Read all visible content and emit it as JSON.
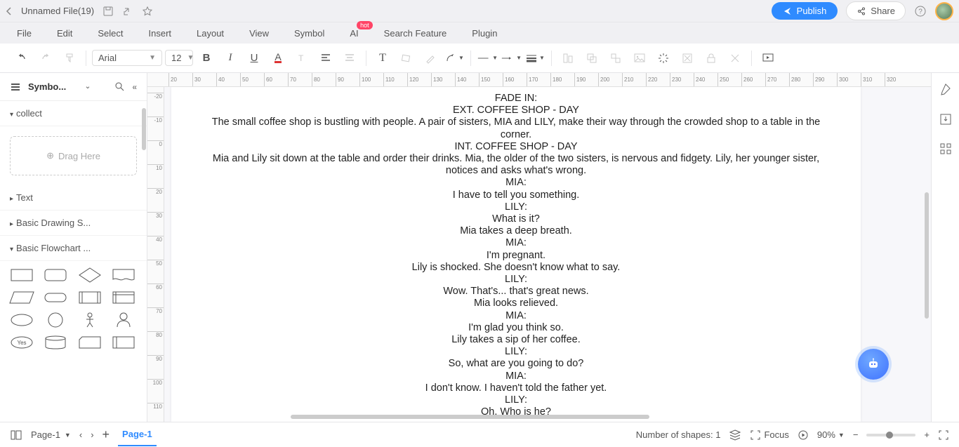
{
  "title": "Unnamed File(19)",
  "publish": "Publish",
  "share": "Share",
  "menu": [
    "File",
    "Edit",
    "Select",
    "Insert",
    "Layout",
    "View",
    "Symbol",
    "AI",
    "Search Feature",
    "Plugin"
  ],
  "ai_badge": "hot",
  "font_name": "Arial",
  "font_size": "12",
  "sidebar": {
    "title": "Symbo...",
    "collect": "collect",
    "drag": "Drag Here",
    "text": "Text",
    "basic_drawing": "Basic Drawing S...",
    "basic_flowchart": "Basic Flowchart ...",
    "yes": "Yes"
  },
  "hruler": [
    "20",
    "30",
    "40",
    "50",
    "60",
    "70",
    "80",
    "90",
    "100",
    "110",
    "120",
    "130",
    "140",
    "150",
    "160",
    "170",
    "180",
    "190",
    "200",
    "210",
    "220",
    "230",
    "240",
    "250",
    "260",
    "270",
    "280",
    "290",
    "300",
    "310",
    "320"
  ],
  "vruler": [
    "-20",
    "-10",
    "0",
    "10",
    "20",
    "30",
    "40",
    "50",
    "60",
    "70",
    "80",
    "90",
    "100",
    "110"
  ],
  "script": [
    "FADE IN:",
    "EXT. COFFEE SHOP - DAY",
    "The small coffee shop is bustling with people. A pair of sisters, MIA and LILY, make their way through the crowded shop to a table in the corner.",
    "INT. COFFEE SHOP - DAY",
    "Mia and Lily sit down at the table and order their drinks. Mia, the older of the two sisters, is nervous and fidgety. Lily, her younger sister, notices and asks what's wrong.",
    "MIA:",
    "I have to tell you something.",
    "LILY:",
    "What is it?",
    "Mia takes a deep breath.",
    "MIA:",
    "I'm pregnant.",
    "Lily is shocked. She doesn't know what to say.",
    "LILY:",
    "Wow. That's... that's great news.",
    "Mia looks relieved.",
    "MIA:",
    "I'm glad you think so.",
    "Lily takes a sip of her coffee.",
    "LILY:",
    "So, what are you going to do?",
    "MIA:",
    "I don't know. I haven't told the father yet.",
    "LILY:",
    "Oh. Who is he?"
  ],
  "status": {
    "page_select": "Page-1",
    "active_tab": "Page-1",
    "shapes": "Number of shapes: 1",
    "focus": "Focus",
    "zoom": "90%"
  }
}
